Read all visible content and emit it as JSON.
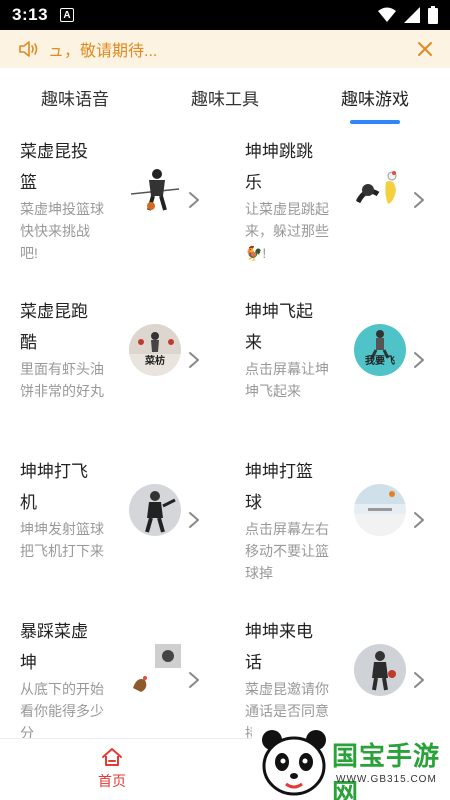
{
  "status_bar": {
    "time": "3:13",
    "notification_badge": "A"
  },
  "notice": {
    "text": "ュ，敬请期待...",
    "accent": "#e08a1f"
  },
  "tabs": [
    {
      "label": "趣味语音",
      "active": false
    },
    {
      "label": "趣味工具",
      "active": false
    },
    {
      "label": "趣味游戏",
      "active": true
    }
  ],
  "games": [
    {
      "title": "菜虚昆投篮",
      "desc": "菜虚坤投篮球快快来挑战吧!",
      "thumb_icon": "basketball-dribble-image"
    },
    {
      "title": "坤坤跳跳乐",
      "desc": "让菜虚昆跳起来，躲过那些🐓!",
      "thumb_icon": "chicken-jump-image"
    },
    {
      "title": "菜虚昆跑酷",
      "desc": "里面有虾头油饼非常的好丸",
      "thumb_icon": "parkour-image",
      "thumb_caption": "菜枋"
    },
    {
      "title": "坤坤飞起来",
      "desc": "点击屏幕让坤坤飞起来",
      "thumb_icon": "flying-image",
      "thumb_caption": "我要飞"
    },
    {
      "title": "坤坤打飞机",
      "desc": "坤坤发射篮球把飞机打下来",
      "thumb_icon": "shooting-image"
    },
    {
      "title": "坤坤打篮球",
      "desc": "点击屏幕左右移动不要让篮球掉",
      "thumb_icon": "basketball-court-image"
    },
    {
      "title": "暴踩菜虚坤",
      "desc": "从底下的开始看你能得多少分",
      "thumb_icon": "stomp-image"
    },
    {
      "title": "坤坤来电话",
      "desc": "菜虚昆邀请你通话是否同意接听",
      "thumb_icon": "phone-call-image"
    }
  ],
  "bottom_nav": {
    "home_label": "首页",
    "accent": "#e53935"
  },
  "watermark": {
    "name": "国宝手游网",
    "url": "WWW.GB315.COM"
  },
  "colors": {
    "tab_indicator": "#2f86f6",
    "title": "#222222",
    "desc": "#999999"
  }
}
